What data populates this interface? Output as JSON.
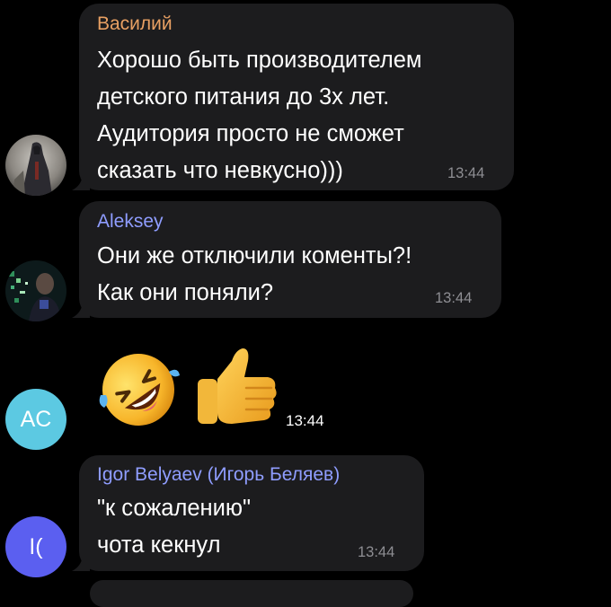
{
  "messages": [
    {
      "sender": "Василий",
      "sender_color": "#e8a063",
      "lines": [
        "Хорошо быть производителем",
        "детского питания до 3х лет.",
        "Аудитория просто не сможет",
        "сказать что невкусно)))"
      ],
      "time": "13:44"
    },
    {
      "sender": "Aleksey",
      "sender_color": "#8f9dff",
      "lines": [
        "Они же отключили коменты?!",
        "Как они поняли?"
      ],
      "time": "13:44"
    },
    {
      "sender": "",
      "sticker": [
        "rolling-on-floor-laughing",
        "thumbs-up"
      ],
      "time": "13:44",
      "avatar_initials": "AC",
      "avatar_color": "#5cc9e2"
    },
    {
      "sender": "Igor Belyaev (Игорь Беляев)",
      "sender_color": "#8f9dff",
      "lines": [
        "\"к сожалению\"",
        "чота кекнул"
      ],
      "time": "13:44",
      "avatar_initials": "I(",
      "avatar_color": "#5b5ff0"
    }
  ],
  "theme": {
    "background": "#000000",
    "bubble": "#1c1c1e",
    "time_color": "#8e8e93"
  }
}
